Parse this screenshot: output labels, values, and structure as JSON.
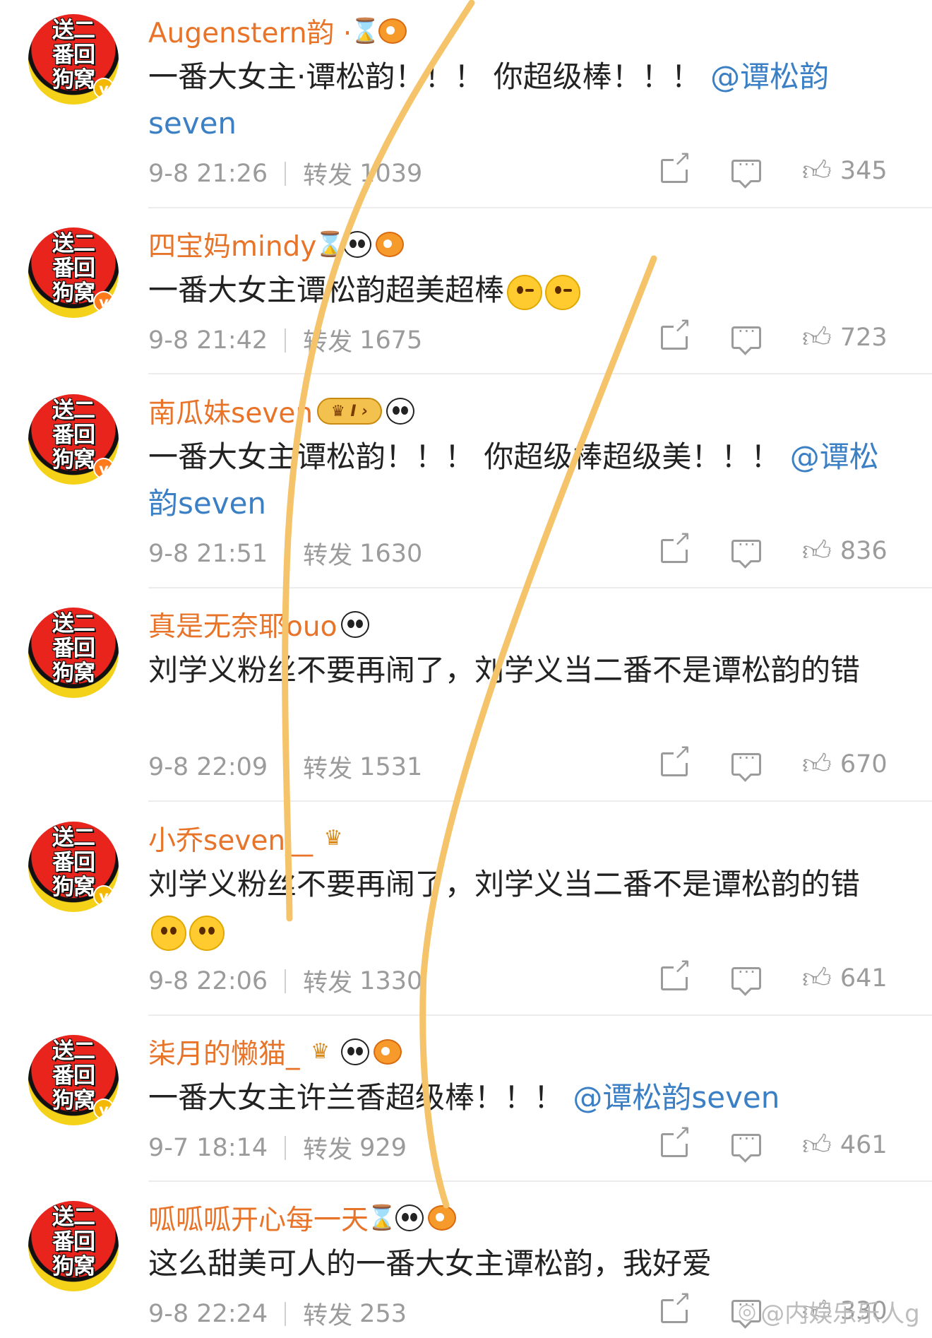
{
  "avatar_text": "送二\n番回\n狗窝",
  "actions": {
    "share_icon": "share-icon",
    "comment_icon": "comment-icon",
    "like_icon": "like-icon"
  },
  "repost_label": "转发",
  "comments": [
    {
      "username": "Augenstern韵 ·",
      "badges": [
        "hourglass",
        "fish"
      ],
      "verified": "gold",
      "body_parts": [
        {
          "type": "text",
          "value": "一番大女主·谭松韵！！！ 你超级棒！！！ "
        },
        {
          "type": "mention",
          "value": "@谭松韵seven"
        }
      ],
      "time": "9-8 21:26",
      "reposts": "1039",
      "likes": "345"
    },
    {
      "username": "四宝妈mindy",
      "badges": [
        "hourglass",
        "panda",
        "fish"
      ],
      "verified": "orange",
      "body_parts": [
        {
          "type": "text",
          "value": "一番大女主谭松韵超美超棒"
        },
        {
          "type": "emoji",
          "value": "kiss"
        },
        {
          "type": "emoji",
          "value": "kiss"
        }
      ],
      "time": "9-8 21:42",
      "reposts": "1675",
      "likes": "723"
    },
    {
      "username": "南瓜妹seven",
      "badges": [
        "crown",
        "panda"
      ],
      "verified": "orange",
      "body_parts": [
        {
          "type": "text",
          "value": "一番大女主谭松韵！！！ 你超级棒超级美！！！ "
        },
        {
          "type": "mention",
          "value": "@谭松韵seven"
        }
      ],
      "time": "9-8 21:51",
      "reposts": "1630",
      "likes": "836"
    },
    {
      "username": "真是无奈耶ouo",
      "badges": [
        "panda"
      ],
      "verified": "",
      "body_parts": [
        {
          "type": "text",
          "value": "刘学义粉丝不要再闹了，刘学义当二番不是谭松韵的错"
        }
      ],
      "time": "9-8 22:09",
      "reposts": "1531",
      "likes": "670"
    },
    {
      "username": "小乔seven__",
      "badges": [
        "chest"
      ],
      "verified": "gold",
      "body_parts": [
        {
          "type": "text",
          "value": "刘学义粉丝不要再闹了，刘学义当二番不是谭松韵的错"
        },
        {
          "type": "emoji",
          "value": "pleading"
        },
        {
          "type": "emoji",
          "value": "pleading"
        }
      ],
      "time": "9-8 22:06",
      "reposts": "1330",
      "likes": "641"
    },
    {
      "username": "柒月的懒猫_",
      "badges": [
        "chest",
        "panda",
        "fish"
      ],
      "verified": "gold",
      "body_parts": [
        {
          "type": "text",
          "value": "一番大女主许兰香超级棒！！！ "
        },
        {
          "type": "mention",
          "value": "@谭松韵seven"
        }
      ],
      "time": "9-7 18:14",
      "reposts": "929",
      "likes": "461"
    },
    {
      "username": "呱呱呱开心每一天",
      "badges": [
        "hourglass",
        "panda",
        "fish"
      ],
      "verified": "",
      "body_parts": [
        {
          "type": "text",
          "value": "这么甜美可人的一番大女主谭松韵，我好爱"
        }
      ],
      "time": "9-8 22:24",
      "reposts": "253",
      "likes": "330"
    }
  ],
  "watermark": "@内娱乐乐人g",
  "colors": {
    "username": "#e8742a",
    "mention": "#3b7fc4",
    "body": "#222222",
    "meta": "#9b9b9b",
    "annotation_stroke": "#f5c46a"
  }
}
